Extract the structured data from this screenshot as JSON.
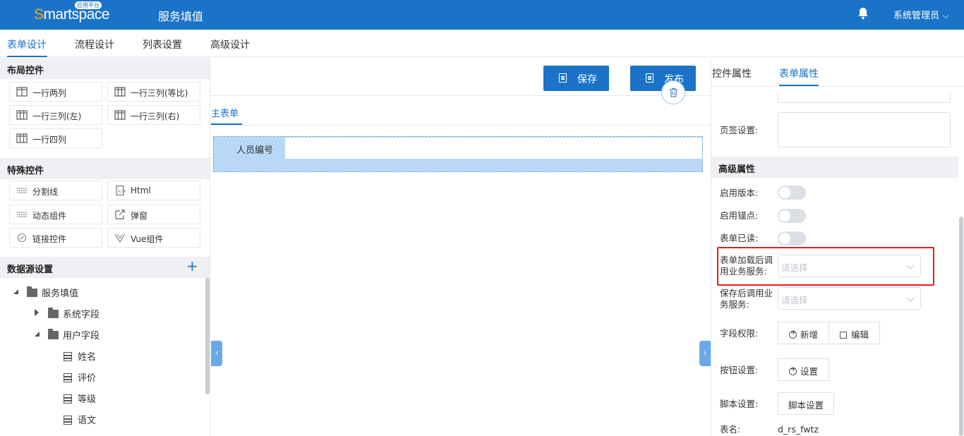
{
  "header": {
    "logo_text": "Smartspace",
    "logo_badge": "应用平台",
    "app_title": "服务填值",
    "user_name": "系统管理员"
  },
  "tabs": [
    "表单设计",
    "流程设计",
    "列表设置",
    "高级设计"
  ],
  "left": {
    "layout_title": "布局控件",
    "layout_controls": [
      "一行两列",
      "一行三列(等比)",
      "一行三列(左)",
      "一行三列(右)",
      "一行四列"
    ],
    "special_title": "特殊控件",
    "special_controls": [
      "分割线",
      "Html",
      "动态组件",
      "弹窗",
      "链接控件",
      "Vue组件"
    ],
    "datasource_title": "数据源设置",
    "tree": {
      "root": "服务填值",
      "system_fields": "系统字段",
      "user_fields": "用户字段",
      "fields": [
        "姓名",
        "评价",
        "等级",
        "语文"
      ]
    }
  },
  "canvas": {
    "save_label": "保存",
    "publish_label": "发布",
    "subtab_label": "主表单",
    "field_label": "人员编号"
  },
  "right": {
    "tab_control": "控件属性",
    "tab_form": "表单属性",
    "page_sign_label": "页签设置:",
    "advanced_title": "高级属性",
    "enable_version_label": "启用版本:",
    "enable_anchor_label": "启用锚点:",
    "form_readonly_label": "表单已读:",
    "after_load_label": "表单加载后调用业务服务:",
    "after_load_placeholder": "请选择",
    "after_save_label": "保存后调用业务服务:",
    "after_save_placeholder": "请选择",
    "field_perm_label": "字段权限:",
    "add_label": "新增",
    "edit_label": "编辑",
    "button_settings_label": "按钮设置:",
    "settings_label": "设置",
    "script_settings_label": "脚本设置:",
    "script_button_label": "脚本设置",
    "table_name_label": "表名:",
    "table_name_value": "d_rs_fwtz"
  },
  "colors": {
    "primary": "#1a73c7",
    "highlight_border": "#e02020",
    "selected_row": "#b9d8f7"
  }
}
